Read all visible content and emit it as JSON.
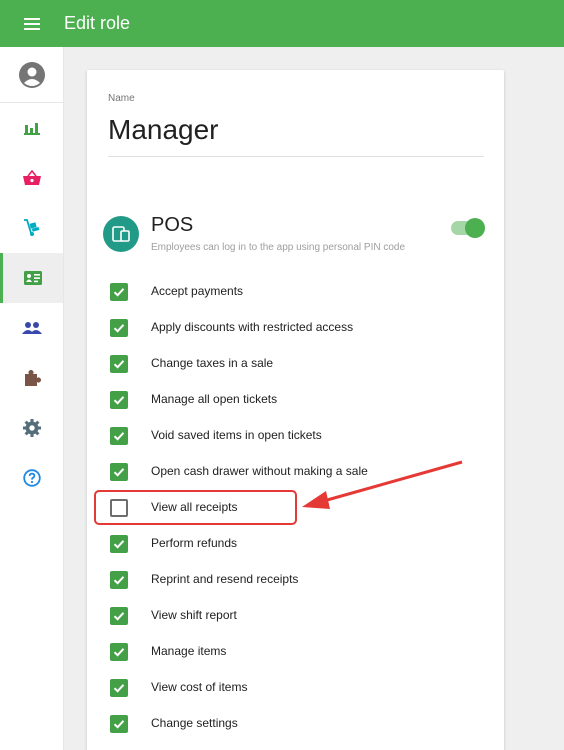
{
  "header": {
    "menu_icon": "hamburger-icon",
    "title": "Edit role"
  },
  "sidebar": {
    "avatar_icon": "account-circle-icon",
    "items": [
      {
        "icon": "bar-chart-icon",
        "active": false
      },
      {
        "icon": "shopping-basket-icon",
        "active": false
      },
      {
        "icon": "hand-truck-icon",
        "active": false
      },
      {
        "icon": "id-card-icon",
        "active": true
      },
      {
        "icon": "people-icon",
        "active": false
      },
      {
        "icon": "puzzle-icon",
        "active": false
      },
      {
        "icon": "gear-icon",
        "active": false
      },
      {
        "icon": "help-circle-icon",
        "active": false
      }
    ]
  },
  "form": {
    "name_label": "Name",
    "name_value": "Manager",
    "section": {
      "icon": "tablet-icon",
      "title": "POS",
      "description": "Employees can log in to the app using personal PIN code",
      "enabled": true
    },
    "permissions": [
      {
        "label": "Accept payments",
        "checked": true
      },
      {
        "label": "Apply discounts with restricted access",
        "checked": true
      },
      {
        "label": "Change taxes in a sale",
        "checked": true
      },
      {
        "label": "Manage all open tickets",
        "checked": true
      },
      {
        "label": "Void saved items in open tickets",
        "checked": true
      },
      {
        "label": "Open cash drawer without making a sale",
        "checked": true
      },
      {
        "label": "View all receipts",
        "checked": false
      },
      {
        "label": "Perform refunds",
        "checked": true
      },
      {
        "label": "Reprint and resend receipts",
        "checked": true
      },
      {
        "label": "View shift report",
        "checked": true
      },
      {
        "label": "Manage items",
        "checked": true
      },
      {
        "label": "View cost of items",
        "checked": true
      },
      {
        "label": "Change settings",
        "checked": true
      }
    ]
  },
  "colors": {
    "primary": "#4caf50",
    "checkbox": "#43a047",
    "annotation": "#e53935",
    "pos_icon_bg": "#219a87"
  }
}
